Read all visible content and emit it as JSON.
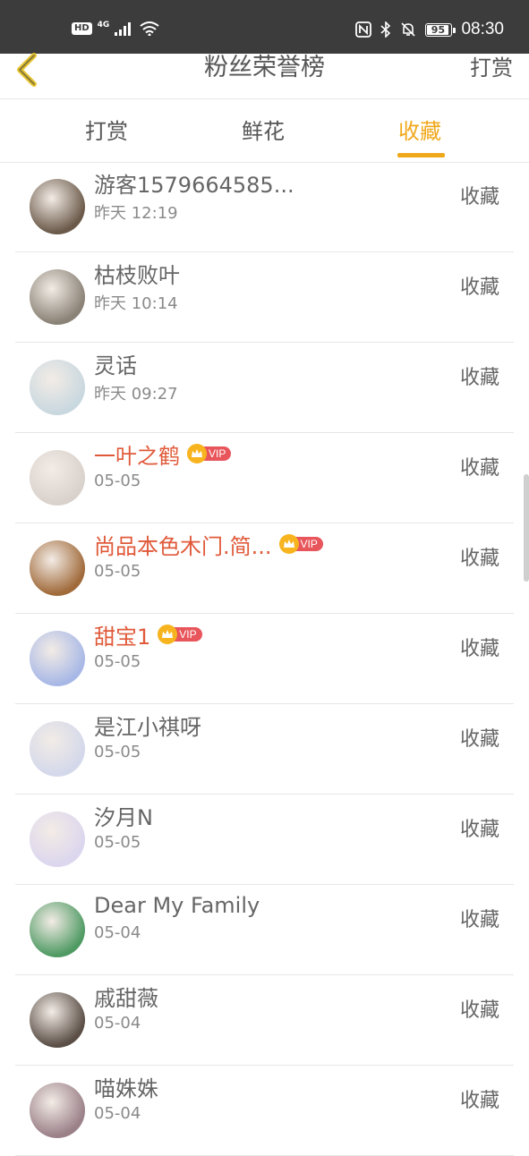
{
  "status_bar": {
    "hd": "HD",
    "network": "4G",
    "battery": "95",
    "time": "08:30"
  },
  "header": {
    "title": "粉丝荣誉榜",
    "action": "打赏"
  },
  "tabs": [
    {
      "label": "打赏"
    },
    {
      "label": "鲜花"
    },
    {
      "label": "收藏"
    }
  ],
  "vip_label": "VIP",
  "rows": [
    {
      "name": "游客1579664585...",
      "time": "昨天 12:19",
      "action": "收藏",
      "vip": false,
      "avatar_color": "#6b5a4a"
    },
    {
      "name": "枯枝败叶",
      "time": "昨天 10:14",
      "action": "收藏",
      "vip": false,
      "avatar_color": "#8a8276"
    },
    {
      "name": "灵话",
      "time": "昨天 09:27",
      "action": "收藏",
      "vip": false,
      "avatar_color": "#c9d8df"
    },
    {
      "name": "一叶之鹤",
      "time": "05-05",
      "action": "收藏",
      "vip": true,
      "avatar_color": "#d9d2cc"
    },
    {
      "name": "尚品本色木门.简...",
      "time": "05-05",
      "action": "收藏",
      "vip": true,
      "avatar_color": "#a06a3a"
    },
    {
      "name": "甜宝1",
      "time": "05-05",
      "action": "收藏",
      "vip": true,
      "avatar_color": "#a8b8e6"
    },
    {
      "name": "是江小祺呀",
      "time": "05-05",
      "action": "收藏",
      "vip": false,
      "avatar_color": "#d3d8ea"
    },
    {
      "name": "汐月N",
      "time": "05-05",
      "action": "收藏",
      "vip": false,
      "avatar_color": "#dcd6ee"
    },
    {
      "name": "Dear My Family",
      "time": "05-04",
      "action": "收藏",
      "vip": false,
      "avatar_color": "#4f9a63"
    },
    {
      "name": "戚甜薇",
      "time": "05-04",
      "action": "收藏",
      "vip": false,
      "avatar_color": "#5a4e46"
    },
    {
      "name": "喵姝姝",
      "time": "05-04",
      "action": "收藏",
      "vip": false,
      "avatar_color": "#9a8088"
    }
  ]
}
